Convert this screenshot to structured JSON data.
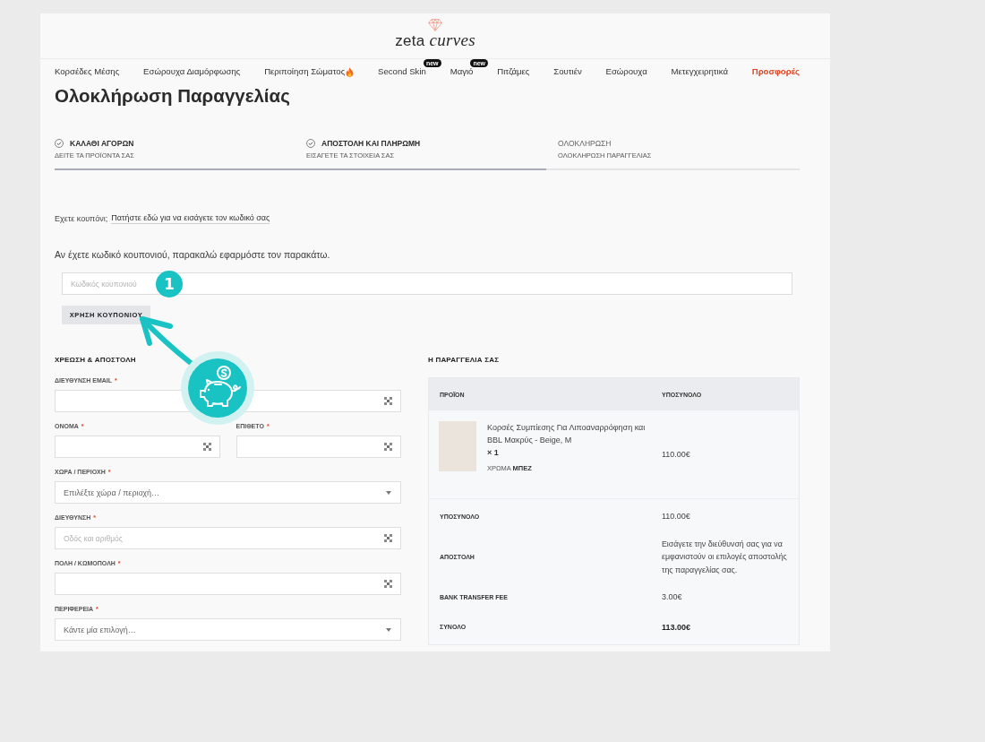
{
  "logo": {
    "text": "zeta *curves*"
  },
  "nav": [
    {
      "label": "Κορσέδες Μέσης",
      "kind": "plain"
    },
    {
      "label": "Εσώρουχα Διαμόρφωσης",
      "kind": "plain"
    },
    {
      "label": "Περιποίηση Σώματος",
      "kind": "flame"
    },
    {
      "label": "Second Skin",
      "kind": "badged",
      "badge": "new"
    },
    {
      "label": "Μαγιό",
      "kind": "badged",
      "badge": "new"
    },
    {
      "label": "Πιτζάμες",
      "kind": "plain"
    },
    {
      "label": "Σουτιέν",
      "kind": "plain"
    },
    {
      "label": "Εσώρουχα",
      "kind": "plain"
    },
    {
      "label": "Μετεγχειρητικά",
      "kind": "plain"
    },
    {
      "label": "Προσφορές",
      "kind": "sale"
    }
  ],
  "page_title": "Ολοκλήρωση Παραγγελίας",
  "steps": [
    {
      "title": "ΚΑΛΑΘΙ ΑΓΟΡΩΝ",
      "subtitle": "ΔΕΙΤΕ ΤΑ ΠΡΟΪΟΝΤΑ ΣΑΣ",
      "completed": true
    },
    {
      "title": "ΑΠΟΣΤΟΛΗ ΚΑΙ ΠΛΗΡΩΜΗ",
      "subtitle": "ΕΙΣΑΓΕΤΕ ΤΑ ΣΤΟΙΧΕΙΑ ΣΑΣ",
      "completed": true
    },
    {
      "title": "ΟΛΟΚΛΗΡΩΣΗ",
      "subtitle": "ΟΛΟΚΛΗΡΩΣΗ ΠΑΡΑΓΓΕΛΙΑΣ",
      "completed": false
    }
  ],
  "progress": {
    "level": 0.66
  },
  "coupon_notice": {
    "text": "Εχετε κουπόνι;",
    "link": "Πατήστε εδώ για να εισάγετε τον κωδικό σας"
  },
  "coupon_form": {
    "instruction": "Αν έχετε κωδικό κουπονιού, παρακαλώ εφαρμόστε τον παρακάτω.",
    "placeholder": "Κωδικός κουπονιού",
    "button": "ΧΡΗΣΗ ΚΟΥΠΟΝΙΟΥ"
  },
  "callout": {
    "number": "1"
  },
  "billing": {
    "heading": "ΧΡΕΩΣΗ & ΑΠΟΣΤΟΛΗ",
    "rows": [
      {
        "fields": [
          {
            "label": "ΔΙΕΥΘΥΝΣΗ EMAIL",
            "required_mark": "*",
            "kind": "text"
          }
        ]
      },
      {
        "fields": [
          {
            "label": "ΟΝΟΜΑ",
            "required_mark": "*",
            "kind": "text"
          },
          {
            "label": "ΕΠΙΘΕΤΟ",
            "required_mark": "*",
            "kind": "text"
          }
        ]
      },
      {
        "fields": [
          {
            "label": "ΧΩΡΑ / ΠΕΡΙΟΧΗ",
            "required_mark": "*",
            "kind": "select",
            "placeholder": "Επιλέξτε χώρα / περιοχή…"
          }
        ]
      },
      {
        "fields": [
          {
            "label": "ΔΙΕΥΘΥΝΣΗ",
            "required_mark": "*",
            "kind": "text",
            "placeholder": "Οδός και αριθμός"
          }
        ]
      },
      {
        "fields": [
          {
            "label": "ΠΟΛΗ / ΚΩΜΟΠΟΛΗ",
            "required_mark": "*",
            "kind": "text"
          }
        ]
      },
      {
        "fields": [
          {
            "label": "ΠΕΡΙΦΕΡΕΙΑ",
            "required_mark": "*",
            "kind": "select",
            "placeholder": "Κάντε μία επιλογή…"
          }
        ]
      }
    ]
  },
  "order": {
    "heading": "Η ΠΑΡΑΓΓΕΛΙΑ ΣΑΣ",
    "columns": [
      "ΠΡΟΪΟΝ",
      "ΥΠΟΣΥΝΟΛΟ"
    ],
    "items": [
      {
        "name": "Κορσές Συμπίεσης Για Λιποαναρρόφηση και BBL Μακρύς - Beige, M",
        "quantity": "× 1",
        "variation": "ΧΡΩΜΑ **ΜΠΕΖ**",
        "subtotal": "110.00€"
      }
    ],
    "totals": [
      {
        "label": "ΥΠΟΣΥΝΟΛΟ",
        "value": "110.00€",
        "kind": "amount"
      },
      {
        "label": "ΑΠΟΣΤΟΛΗ",
        "value": "Εισάγετε την διεύθυνσή σας για να εμφανιστούν οι επιλογές αποστολής της παραγγελίας σας.",
        "kind": "note"
      },
      {
        "label": "BANK TRANSFER FEE",
        "value": "3.00€",
        "kind": "amount"
      },
      {
        "label": "ΣΥΝΟΛΟ",
        "value": "113.00€",
        "kind": "total"
      }
    ]
  }
}
